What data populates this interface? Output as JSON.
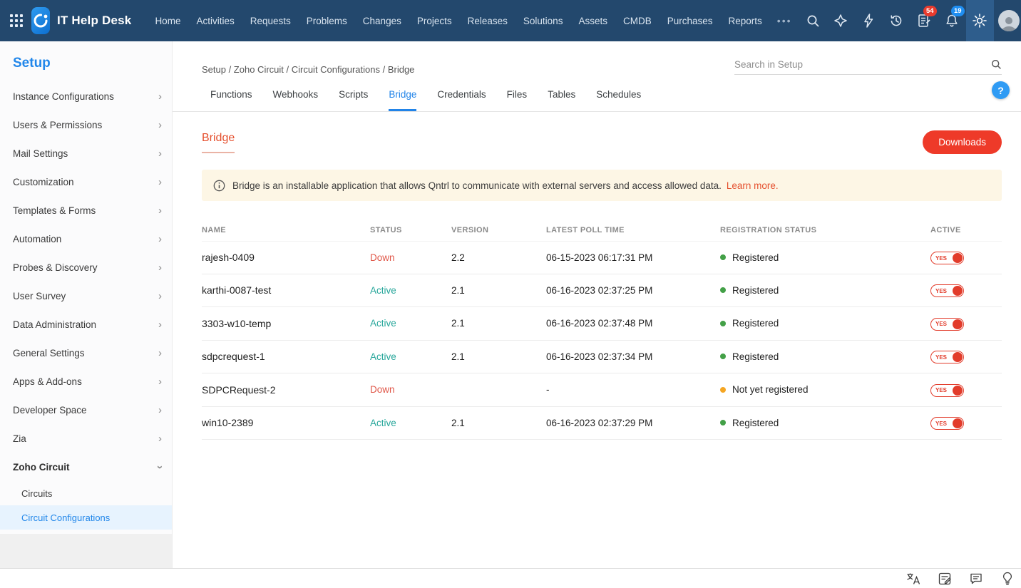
{
  "topnav": {
    "app_title": "IT Help Desk",
    "items": [
      "Home",
      "Activities",
      "Requests",
      "Problems",
      "Changes",
      "Projects",
      "Releases",
      "Solutions",
      "Assets",
      "CMDB",
      "Purchases",
      "Reports"
    ],
    "more_label": "•••",
    "badges": {
      "tasks": "54",
      "notifications": "19"
    }
  },
  "sidebar": {
    "title": "Setup",
    "items": [
      {
        "label": "Instance Configurations"
      },
      {
        "label": "Users & Permissions"
      },
      {
        "label": "Mail Settings"
      },
      {
        "label": "Customization"
      },
      {
        "label": "Templates & Forms"
      },
      {
        "label": "Automation"
      },
      {
        "label": "Probes & Discovery"
      },
      {
        "label": "User Survey"
      },
      {
        "label": "Data Administration"
      },
      {
        "label": "General Settings"
      },
      {
        "label": "Apps & Add-ons"
      },
      {
        "label": "Developer Space"
      },
      {
        "label": "Zia"
      },
      {
        "label": "Zoho Circuit",
        "expanded": true,
        "children": [
          {
            "label": "Circuits"
          },
          {
            "label": "Circuit Configurations",
            "selected": true
          }
        ]
      }
    ]
  },
  "content": {
    "breadcrumb": "Setup / Zoho Circuit / Circuit Configurations / Bridge",
    "search_placeholder": "Search in Setup",
    "help_label": "?",
    "tabs": [
      "Functions",
      "Webhooks",
      "Scripts",
      "Bridge",
      "Credentials",
      "Files",
      "Tables",
      "Schedules"
    ],
    "active_tab": "Bridge",
    "section_title": "Bridge",
    "downloads_button": "Downloads",
    "info_text": "Bridge is an installable application that allows Qntrl to communicate with external servers and access allowed data.",
    "learn_more": "Learn more.",
    "table": {
      "headers": [
        "NAME",
        "STATUS",
        "VERSION",
        "LATEST POLL TIME",
        "REGISTRATION STATUS",
        "ACTIVE"
      ],
      "rows": [
        {
          "name": "rajesh-0409",
          "status": "Down",
          "version": "2.2",
          "poll_time": "06-15-2023 06:17:31 PM",
          "registration": "Registered",
          "registration_state": "green",
          "active_label": "YES"
        },
        {
          "name": "karthi-0087-test",
          "status": "Active",
          "version": "2.1",
          "poll_time": "06-16-2023 02:37:25 PM",
          "registration": "Registered",
          "registration_state": "green",
          "active_label": "YES"
        },
        {
          "name": "3303-w10-temp",
          "status": "Active",
          "version": "2.1",
          "poll_time": "06-16-2023 02:37:48 PM",
          "registration": "Registered",
          "registration_state": "green",
          "active_label": "YES"
        },
        {
          "name": "sdpcrequest-1",
          "status": "Active",
          "version": "2.1",
          "poll_time": "06-16-2023 02:37:34 PM",
          "registration": "Registered",
          "registration_state": "green",
          "active_label": "YES"
        },
        {
          "name": "SDPCRequest-2",
          "status": "Down",
          "version": "",
          "poll_time": "-",
          "registration": "Not yet registered",
          "registration_state": "orange",
          "active_label": "YES"
        },
        {
          "name": "win10-2389",
          "status": "Active",
          "version": "2.1",
          "poll_time": "06-16-2023 02:37:29 PM",
          "registration": "Registered",
          "registration_state": "green",
          "active_label": "YES"
        }
      ]
    }
  },
  "colors": {
    "navbar": "#23486d",
    "accent_blue": "#2287ea",
    "accent_red": "#ee3a29",
    "status_active": "#26a69a",
    "status_down": "#e0584a",
    "dot_green": "#43a047",
    "dot_orange": "#f5a623",
    "banner_bg": "#fdf6e5"
  }
}
